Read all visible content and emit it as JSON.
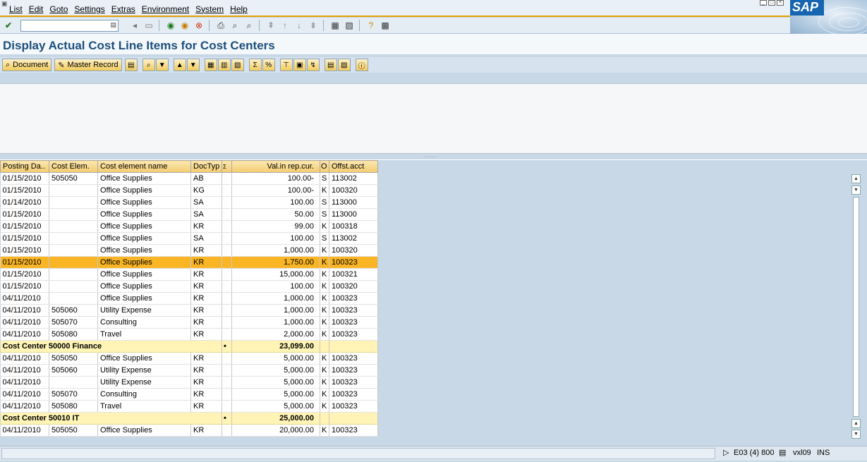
{
  "menubar": {
    "items": [
      "List",
      "Edit",
      "Goto",
      "Settings",
      "Extras",
      "Environment",
      "System",
      "Help"
    ]
  },
  "command_field": {
    "value": ""
  },
  "logo": {
    "text": "SAP"
  },
  "title": "Display Actual Cost Line Items for Cost Centers",
  "app_toolbar": {
    "document_label": "Document",
    "master_record_label": "Master Record"
  },
  "grid": {
    "columns": [
      "Posting Da..",
      "Cost Elem.",
      "Cost element name",
      "DocTyp",
      "Σ",
      "Val.in rep.cur.",
      "O",
      "Offst.acct"
    ],
    "rows": [
      {
        "date": "01/15/2010",
        "elem": "505050",
        "name": "Office Supplies",
        "doctype": "AB",
        "value": "100.00-",
        "o": "S",
        "offset": "113002",
        "type": "row"
      },
      {
        "date": "01/15/2010",
        "elem": "",
        "name": "Office Supplies",
        "doctype": "KG",
        "value": "100.00-",
        "o": "K",
        "offset": "100320",
        "type": "row"
      },
      {
        "date": "01/14/2010",
        "elem": "",
        "name": "Office Supplies",
        "doctype": "SA",
        "value": "100.00",
        "o": "S",
        "offset": "113000",
        "type": "row"
      },
      {
        "date": "01/15/2010",
        "elem": "",
        "name": "Office Supplies",
        "doctype": "SA",
        "value": "50.00",
        "o": "S",
        "offset": "113000",
        "type": "row"
      },
      {
        "date": "01/15/2010",
        "elem": "",
        "name": "Office Supplies",
        "doctype": "KR",
        "value": "99.00",
        "o": "K",
        "offset": "100318",
        "type": "row"
      },
      {
        "date": "01/15/2010",
        "elem": "",
        "name": "Office Supplies",
        "doctype": "SA",
        "value": "100.00",
        "o": "S",
        "offset": "113002",
        "type": "row"
      },
      {
        "date": "01/15/2010",
        "elem": "",
        "name": "Office Supplies",
        "doctype": "KR",
        "value": "1,000.00",
        "o": "K",
        "offset": "100320",
        "type": "row"
      },
      {
        "date": "01/15/2010",
        "elem": "",
        "name": "Office Supplies",
        "doctype": "KR",
        "value": "1,750.00",
        "o": "K",
        "offset": "100323",
        "type": "sel"
      },
      {
        "date": "01/15/2010",
        "elem": "",
        "name": "Office Supplies",
        "doctype": "KR",
        "value": "15,000.00",
        "o": "K",
        "offset": "100321",
        "type": "row"
      },
      {
        "date": "01/15/2010",
        "elem": "",
        "name": "Office Supplies",
        "doctype": "KR",
        "value": "100.00",
        "o": "K",
        "offset": "100320",
        "type": "row"
      },
      {
        "date": "04/11/2010",
        "elem": "",
        "name": "Office Supplies",
        "doctype": "KR",
        "value": "1,000.00",
        "o": "K",
        "offset": "100323",
        "type": "row"
      },
      {
        "date": "04/11/2010",
        "elem": "505060",
        "name": "Utility Expense",
        "doctype": "KR",
        "value": "1,000.00",
        "o": "K",
        "offset": "100323",
        "type": "row"
      },
      {
        "date": "04/11/2010",
        "elem": "505070",
        "name": "Consulting",
        "doctype": "KR",
        "value": "1,000.00",
        "o": "K",
        "offset": "100323",
        "type": "row"
      },
      {
        "date": "04/11/2010",
        "elem": "505080",
        "name": "Travel",
        "doctype": "KR",
        "value": "2,000.00",
        "o": "K",
        "offset": "100323",
        "type": "row"
      },
      {
        "label": "Cost Center 50000 Finance",
        "marker": "•",
        "value": "23,099.00",
        "type": "sum"
      },
      {
        "date": "04/11/2010",
        "elem": "505050",
        "name": "Office Supplies",
        "doctype": "KR",
        "value": "5,000.00",
        "o": "K",
        "offset": "100323",
        "type": "row"
      },
      {
        "date": "04/11/2010",
        "elem": "505060",
        "name": "Utility Expense",
        "doctype": "KR",
        "value": "5,000.00",
        "o": "K",
        "offset": "100323",
        "type": "row"
      },
      {
        "date": "04/11/2010",
        "elem": "",
        "name": "Utility Expense",
        "doctype": "KR",
        "value": "5,000.00",
        "o": "K",
        "offset": "100323",
        "type": "row"
      },
      {
        "date": "04/11/2010",
        "elem": "505070",
        "name": "Consulting",
        "doctype": "KR",
        "value": "5,000.00",
        "o": "K",
        "offset": "100323",
        "type": "row"
      },
      {
        "date": "04/11/2010",
        "elem": "505080",
        "name": "Travel",
        "doctype": "KR",
        "value": "5,000.00",
        "o": "K",
        "offset": "100323",
        "type": "row"
      },
      {
        "label": "Cost Center 50010 IT",
        "marker": "•",
        "value": "25,000.00",
        "type": "sum"
      },
      {
        "date": "04/11/2010",
        "elem": "505050",
        "name": "Office Supplies",
        "doctype": "KR",
        "value": "20,000.00",
        "o": "K",
        "offset": "100323",
        "type": "row"
      }
    ]
  },
  "statusbar": {
    "system": "E03 (4) 800",
    "server": "vxl09",
    "mode": "INS"
  }
}
